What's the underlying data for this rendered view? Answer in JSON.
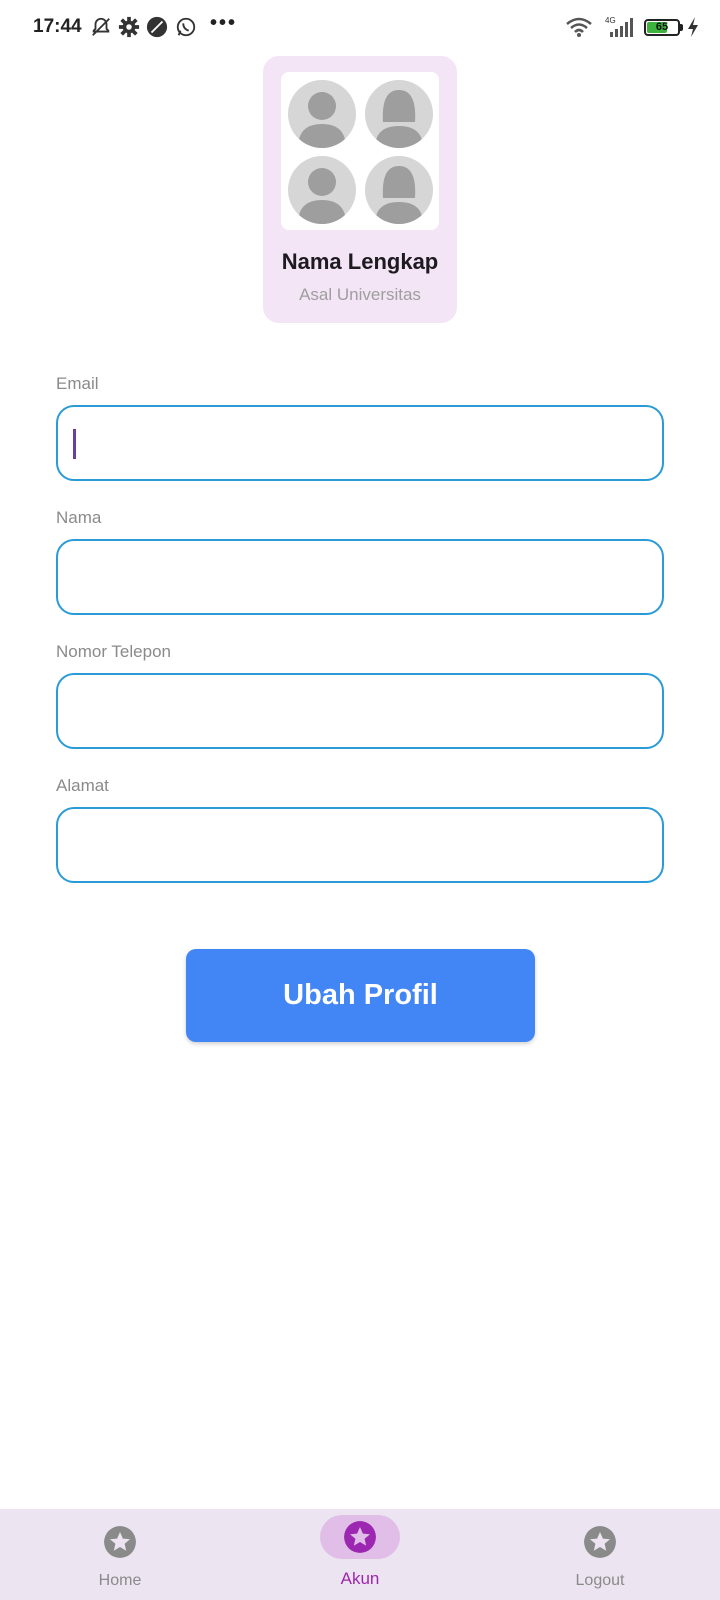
{
  "status_bar": {
    "time": "17:44",
    "icons": [
      "mute-icon",
      "gear-icon",
      "leaf-app-icon",
      "whatsapp-icon",
      "more-dots-icon",
      "wifi-icon",
      "cell-signal-icon",
      "battery-icon",
      "charging-icon"
    ],
    "more": "•••",
    "network": "4G",
    "battery_level": "65"
  },
  "profile": {
    "name": "Nama Lengkap",
    "university": "Asal Universitas",
    "avatar_icon": "group-avatar-icon"
  },
  "form": {
    "fields": [
      {
        "label": "Email",
        "value": ""
      },
      {
        "label": "Nama",
        "value": ""
      },
      {
        "label": "Nomor Telepon",
        "value": ""
      },
      {
        "label": "Alamat",
        "value": ""
      }
    ],
    "submit_label": "Ubah Profil"
  },
  "bottom_nav": {
    "items": [
      {
        "label": "Home",
        "icon": "star-icon",
        "active": false
      },
      {
        "label": "Akun",
        "icon": "star-icon",
        "active": true
      },
      {
        "label": "Logout",
        "icon": "star-icon",
        "active": false
      }
    ]
  },
  "colors": {
    "accent": "#9c27b0",
    "button": "#4285f4",
    "input_border": "#2a9bd6",
    "card_bg": "#f3e5f5",
    "nav_bg": "#ece4f0"
  }
}
